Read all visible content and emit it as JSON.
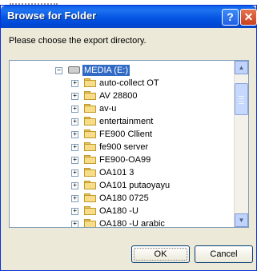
{
  "window": {
    "title": "Browse for Folder",
    "help_label": "?",
    "close_label": "✕"
  },
  "prompt": "Please choose the export directory.",
  "tree": {
    "root": {
      "label": "MEDIA (E:)",
      "expander": "−",
      "icon": "drive-icon",
      "selected": true
    },
    "items": [
      {
        "label": "auto-collect OT",
        "expander": "+"
      },
      {
        "label": "AV 28800",
        "expander": "+"
      },
      {
        "label": "av-u",
        "expander": "+"
      },
      {
        "label": "entertainment",
        "expander": "+"
      },
      {
        "label": "FE900 Cllient",
        "expander": "+"
      },
      {
        "label": "fe900 server",
        "expander": "+"
      },
      {
        "label": "FE900-OA99",
        "expander": "+"
      },
      {
        "label": "OA101 3",
        "expander": "+"
      },
      {
        "label": "OA101 putaoyayu",
        "expander": "+"
      },
      {
        "label": "OA180 0725",
        "expander": "+"
      },
      {
        "label": "OA180 -U",
        "expander": "+"
      },
      {
        "label": "OA180 -U arabic",
        "expander": "+"
      }
    ]
  },
  "scrollbar": {
    "up_label": "▲",
    "down_label": "▼"
  },
  "buttons": {
    "ok": "OK",
    "cancel": "Cancel"
  },
  "colors": {
    "titlebar": "#0554e3",
    "selection": "#316ac5",
    "dialog_bg": "#ece9d8"
  }
}
